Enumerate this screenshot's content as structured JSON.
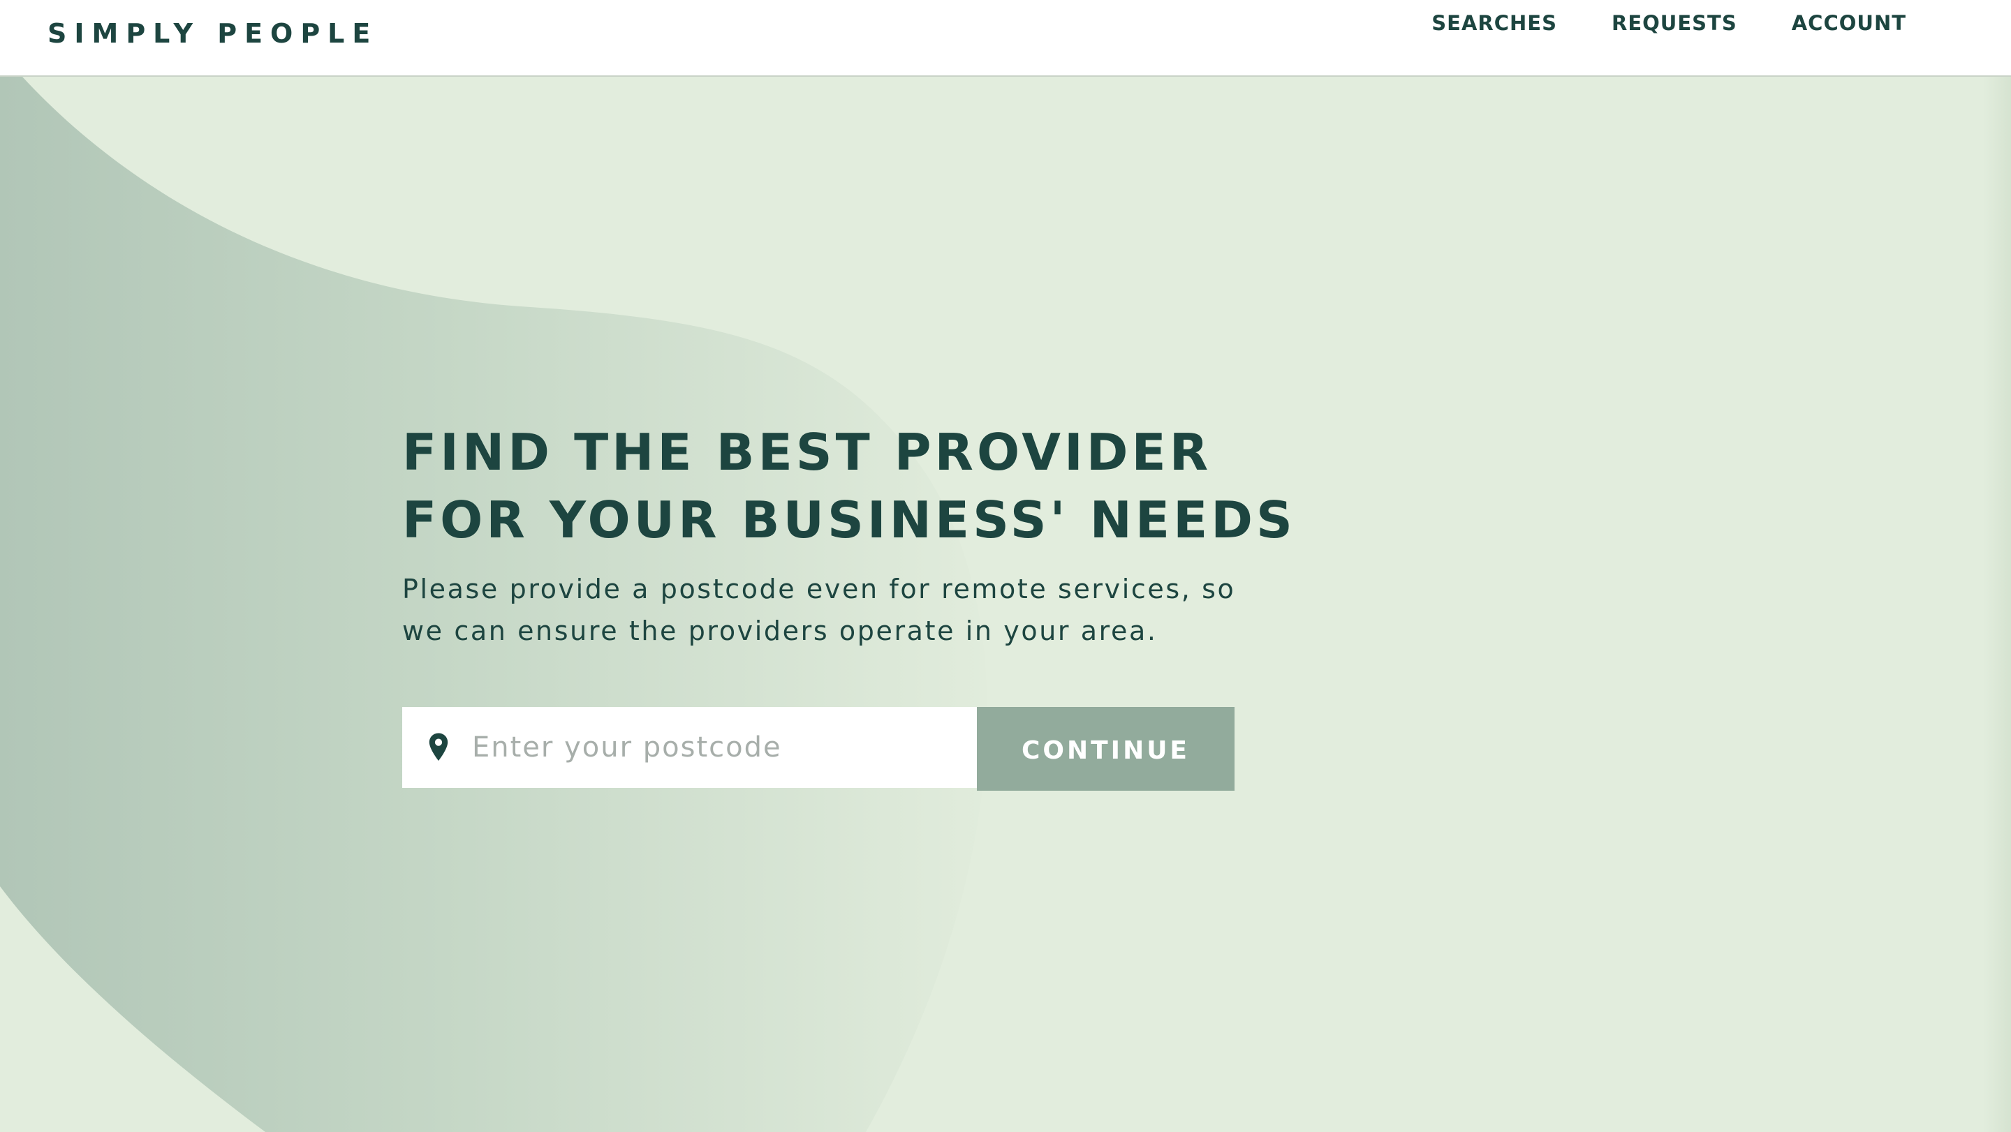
{
  "header": {
    "logo": "SIMPLY PEOPLE",
    "nav": [
      {
        "label": "SEARCHES"
      },
      {
        "label": "REQUESTS"
      },
      {
        "label": "ACCOUNT"
      }
    ]
  },
  "hero": {
    "title_line1": "FIND THE BEST PROVIDER",
    "title_line2": "FOR YOUR BUSINESS' NEEDS",
    "subtitle": "Please provide a postcode even for remote services, so we can ensure the providers operate in your area."
  },
  "search": {
    "icon": "location-pin-icon",
    "placeholder": "Enter your postcode",
    "value": "",
    "button_label": "CONTINUE"
  },
  "colors": {
    "brand_dark": "#1d4540",
    "background": "#e2eddd",
    "blob": "#b3c7b8",
    "button": "#92ab9c",
    "header_bg": "#ffffff"
  }
}
